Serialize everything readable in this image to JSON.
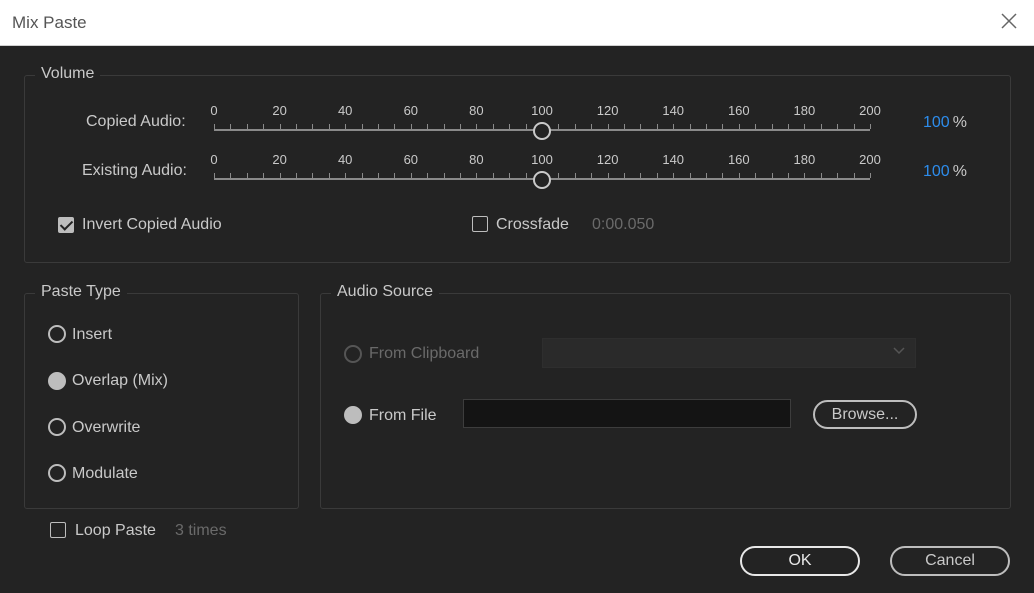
{
  "window": {
    "title": "Mix Paste"
  },
  "volume": {
    "legend": "Volume",
    "scale_labels": [
      "0",
      "20",
      "40",
      "60",
      "80",
      "100",
      "120",
      "140",
      "160",
      "180",
      "200"
    ],
    "scale_min": 0,
    "scale_max": 200,
    "copied": {
      "label": "Copied Audio:",
      "value": 100,
      "value_text": "100",
      "unit": "%"
    },
    "existing": {
      "label": "Existing Audio:",
      "value": 100,
      "value_text": "100",
      "unit": "%"
    },
    "invert": {
      "label": "Invert Copied Audio",
      "checked": true
    },
    "crossfade": {
      "label": "Crossfade",
      "checked": false,
      "value": "0:00.050"
    }
  },
  "paste_type": {
    "legend": "Paste Type",
    "options": [
      {
        "label": "Insert",
        "selected": false
      },
      {
        "label": "Overlap (Mix)",
        "selected": true
      },
      {
        "label": "Overwrite",
        "selected": false
      },
      {
        "label": "Modulate",
        "selected": false
      }
    ]
  },
  "audio_source": {
    "legend": "Audio Source",
    "from_clipboard": {
      "label": "From Clipboard",
      "enabled": false,
      "selected": false
    },
    "from_file": {
      "label": "From File",
      "selected": true,
      "value": ""
    },
    "browse_label": "Browse..."
  },
  "loop": {
    "label": "Loop Paste",
    "checked": false,
    "times_label": "3 times"
  },
  "buttons": {
    "ok": "OK",
    "cancel": "Cancel"
  },
  "icons": {
    "close": "close-icon",
    "dropdown": "chevron-down-icon"
  }
}
